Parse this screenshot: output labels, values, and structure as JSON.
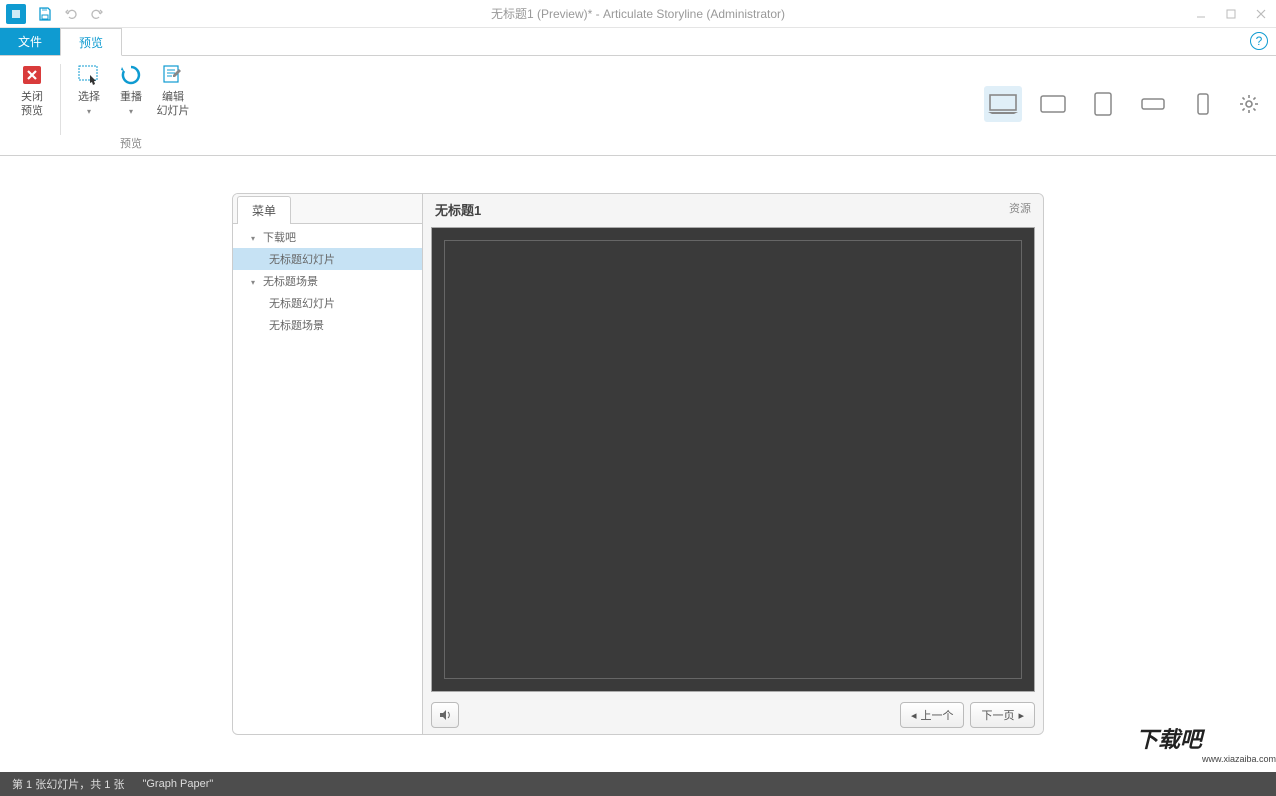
{
  "titlebar": {
    "title": "无标题1 (Preview)*  -  Articulate Storyline (Administrator)"
  },
  "tabs": {
    "file": "文件",
    "preview": "预览"
  },
  "ribbon": {
    "close_preview_l1": "关闭",
    "close_preview_l2": "预览",
    "select": "选择",
    "replay": "重播",
    "edit_slide_l1": "编辑",
    "edit_slide_l2": "幻灯片",
    "group_preview": "预览"
  },
  "sidebar": {
    "menu_tab": "菜单",
    "items": [
      {
        "label": "下载吧",
        "type": "parent"
      },
      {
        "label": "无标题幻灯片",
        "type": "child",
        "selected": true
      },
      {
        "label": "无标题场景",
        "type": "parent"
      },
      {
        "label": "无标题幻灯片",
        "type": "child"
      },
      {
        "label": "无标题场景",
        "type": "child"
      }
    ]
  },
  "slide": {
    "title": "无标题1",
    "resources": "资源",
    "prev": "上一个",
    "next": "下一页"
  },
  "statusbar": {
    "slide_info": "第 1 张幻灯片，共 1 张",
    "theme": "\"Graph Paper\""
  },
  "watermark": {
    "text": "下载吧",
    "url": "www.xiazaiba.com"
  }
}
